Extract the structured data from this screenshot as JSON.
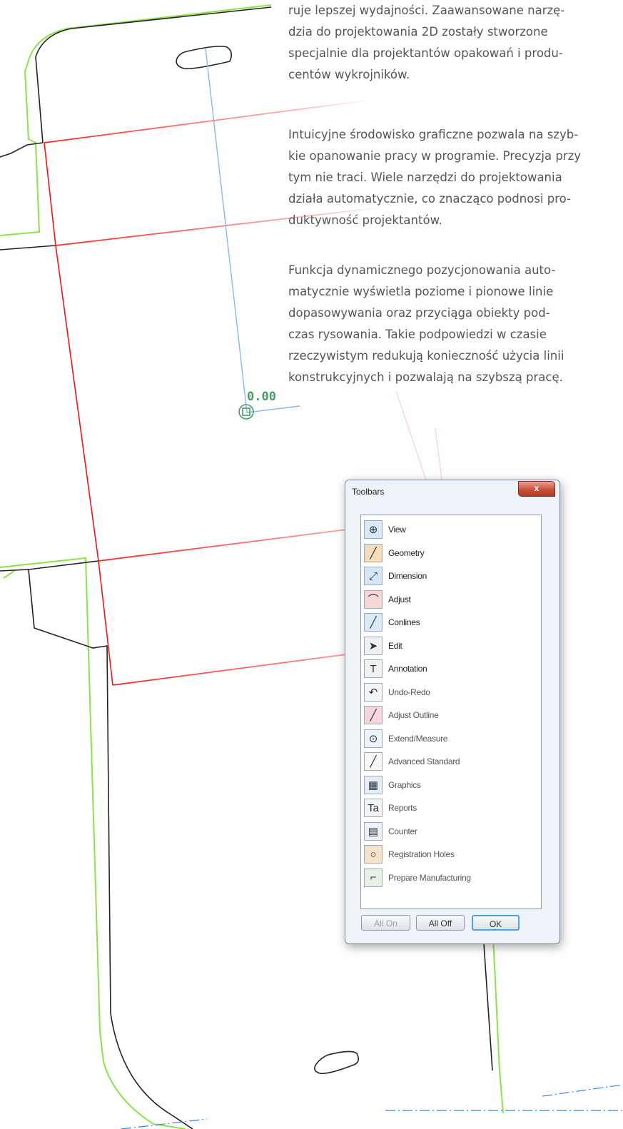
{
  "text": {
    "para1": "ruje lepszej wydajności. Zaawansowane narzę-\ndzia do projektowania 2D zostały stworzone\nspecjalnie dla projektantów opakowań i produ-\ncentów wykrojników.",
    "para2": "Intuicyjne środowisko graficzne pozwala na szyb-\nkie opanowanie pracy w programie. Precyzja przy\ntym nie traci. Wiele narzędzi do projektowania\ndziała automatycznie, co znacząco podnosi pro-\nduktywność projektantów.",
    "para3": "Funkcja dynamicznego pozycjonowania auto-\nmatycznie wyświetla poziome i pionowe linie\ndopasowywania oraz przyciąga obiekty pod-\nczas rysowania. Takie podpowiedzi w czasie\nrzeczywistym redukują konieczność użycia linii\nkonstrukcyjnych i pozwalają na szybszą pracę."
  },
  "readout": "0.00",
  "dialog": {
    "title": "Toolbars",
    "close_label": "x",
    "items": [
      {
        "label": "View",
        "icon": "magnifier-icon",
        "glyph": "⊕",
        "bg": "#dbe8f5",
        "on": true
      },
      {
        "label": "Geometry",
        "icon": "line-icon",
        "glyph": "╱",
        "bg": "#f4dcb8",
        "on": true
      },
      {
        "label": "Dimension",
        "icon": "dimension-arrow-icon",
        "glyph": "⤢",
        "bg": "#d6e6f6",
        "on": true
      },
      {
        "label": "Adjust",
        "icon": "fillet-icon",
        "glyph": "⌒",
        "bg": "#f6d6d6",
        "on": true
      },
      {
        "label": "Conlines",
        "icon": "conline-icon",
        "glyph": "╱",
        "bg": "#dceaf7",
        "on": true
      },
      {
        "label": "Edit",
        "icon": "pointer-icon",
        "glyph": "➤",
        "bg": "#f0f0f0",
        "on": true
      },
      {
        "label": "Annotation",
        "icon": "text-t-icon",
        "glyph": "T",
        "bg": "#f0f0f0",
        "on": true
      },
      {
        "label": "Undo-Redo",
        "icon": "undo-icon",
        "glyph": "↶",
        "bg": "#f4f4f4",
        "on": false
      },
      {
        "label": "Adjust Outline",
        "icon": "adjust-outline-icon",
        "glyph": "╱",
        "bg": "#f6d6dc",
        "on": false
      },
      {
        "label": "Extend/Measure",
        "icon": "extend-measure-icon",
        "glyph": "⊙",
        "bg": "#eef3fa",
        "on": false
      },
      {
        "label": "Advanced Standard",
        "icon": "advanced-line-icon",
        "glyph": "╱",
        "bg": "#f6f6f6",
        "on": false
      },
      {
        "label": "Graphics",
        "icon": "graphics-icon",
        "glyph": "▦",
        "bg": "#e6edf6",
        "on": false
      },
      {
        "label": "Reports",
        "icon": "text-ta-icon",
        "glyph": "Ta",
        "bg": "#f4f4f4",
        "on": false
      },
      {
        "label": "Counter",
        "icon": "counter-icon",
        "glyph": "▤",
        "bg": "#eef0f4",
        "on": false
      },
      {
        "label": "Registration Holes",
        "icon": "registration-hole-icon",
        "glyph": "○",
        "bg": "#f6e2c8",
        "on": false
      },
      {
        "label": "Prepare Manufacturing",
        "icon": "manufacturing-icon",
        "glyph": "⌐",
        "bg": "#e8f2e4",
        "on": false
      }
    ],
    "buttons": {
      "all_on": "All On",
      "all_off": "All Off",
      "ok": "OK"
    }
  }
}
